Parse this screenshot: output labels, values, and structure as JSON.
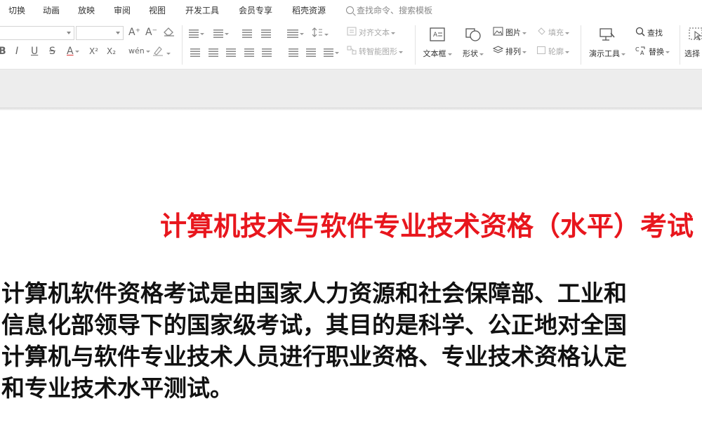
{
  "menu": {
    "tabs": [
      "切换",
      "动画",
      "放映",
      "审阅",
      "视图",
      "开发工具",
      "会员专享",
      "稻壳资源"
    ],
    "search_label": "查找命令、搜索模板"
  },
  "ribbon": {
    "text_format": {
      "bold": "B",
      "italic": "I",
      "underline": "U",
      "strike": "S",
      "font_color": "A",
      "superscript": "X²",
      "subscript": "X₂",
      "phonetic": "wén",
      "grow": "A⁺",
      "shrink": "A⁻"
    },
    "align_text_label": "对齐文本",
    "smartart_label": "转智能图形",
    "textbox_label": "文本框",
    "shape_label": "形状",
    "picture_label": "图片",
    "arrange_label": "排列",
    "fill_label": "填充",
    "outline_label": "轮廓",
    "presenter_tools_label": "演示工具",
    "find_label": "查找",
    "replace_label": "替换",
    "select_label": "选择"
  },
  "slide": {
    "title": "计算机技术与软件专业技术资格（水平）考试",
    "body_lines": [
      "计算机软件资格考试是由国家人力资源和社会保障部、工业和",
      "信息化部领导下的国家级考试，其目的是科学、公正地对全国",
      "计算机与软件专业技术人员进行职业资格、专业技术资格认定",
      "和专业技术水平测试。"
    ]
  },
  "colors": {
    "title_red": "#e8161d",
    "body_black": "#111111",
    "strip_gray": "#ededed"
  }
}
